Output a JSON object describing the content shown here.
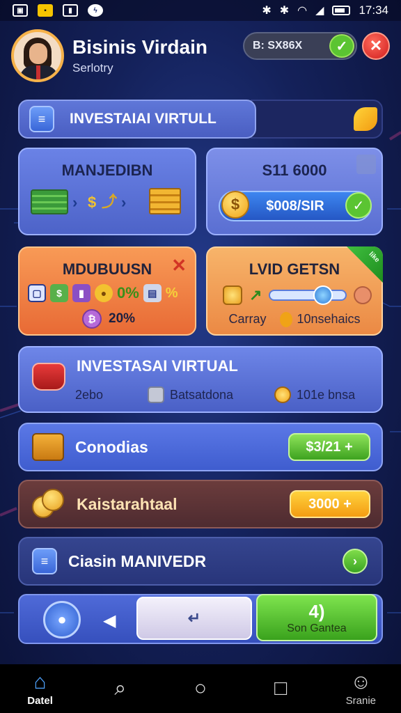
{
  "status_bar": {
    "time": "17:34",
    "icons": [
      "image-icon",
      "game-icon",
      "lock-icon",
      "bolt-icon",
      "bluetooth-icon",
      "bluetooth-icon",
      "wifi-icon",
      "signal-icon",
      "battery-icon"
    ]
  },
  "header": {
    "user_name": "Bisinis Virdain",
    "user_subtitle": "Serlotry",
    "balance": "B: SX86X",
    "balance_check": "✓",
    "close": "✕"
  },
  "title_bar": {
    "label": "INVESTAIAI VIRTULL"
  },
  "cards": {
    "card_a": {
      "title": "MANJEDIBN"
    },
    "card_b": {
      "title": "S11 6000",
      "button": "$008/SIR",
      "coin": "$",
      "check": "✓"
    },
    "card_c": {
      "title": "MDUBUUSN",
      "percent_1": "0%",
      "percent_small": "%",
      "percent_2": "20%"
    },
    "card_d": {
      "title": "LVID GETSN",
      "ribbon": "like",
      "left_label": "Carray",
      "right_label": "10nsehaics"
    }
  },
  "invest_card": {
    "title": "INVESTASAI VIRTUAL",
    "item_1": "2ebo",
    "item_2": "Batsatdona",
    "item_3": "101e bnsa"
  },
  "rows": {
    "row_1": {
      "label": "Conodias",
      "pill": "$3/21 +"
    },
    "row_2": {
      "label": "Kaistarahtaal",
      "pill": "3000 +"
    },
    "row_3": {
      "label": "Ciasin MANIVEDR",
      "action": "›"
    }
  },
  "bottom_panel": {
    "left_arrow": "◀",
    "white_button": "↵",
    "green_big": "4)",
    "green_small": "Son Gantea"
  },
  "navbar": {
    "items": [
      {
        "label": "Datel",
        "icon": "home-icon",
        "glyph": "⌂"
      },
      {
        "label": "",
        "icon": "search-icon",
        "glyph": "⌕"
      },
      {
        "label": "",
        "icon": "circle-home-icon",
        "glyph": "○"
      },
      {
        "label": "",
        "icon": "recent-apps-icon",
        "glyph": "□"
      },
      {
        "label": "Sranie",
        "icon": "profile-icon",
        "glyph": "☺"
      }
    ]
  },
  "colors": {
    "background": "#14215a",
    "accent_green": "#5bc432",
    "accent_orange": "#f39c12",
    "accent_red": "#d01d1d",
    "panel_blue": "#4d63c8"
  }
}
